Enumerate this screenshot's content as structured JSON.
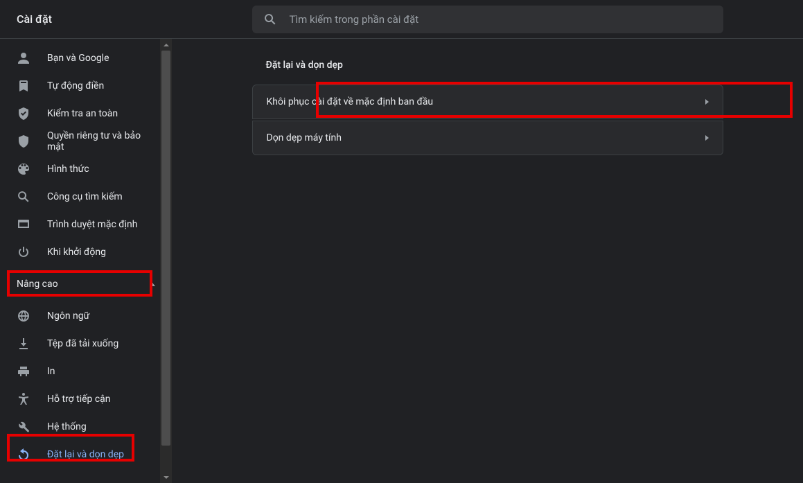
{
  "header": {
    "title": "Cài đặt",
    "search_placeholder": "Tìm kiếm trong phần cài đặt"
  },
  "sidebar": {
    "basic": [
      {
        "icon": "person",
        "label": "Bạn và Google"
      },
      {
        "icon": "autofill",
        "label": "Tự động điền"
      },
      {
        "icon": "safety",
        "label": "Kiểm tra an toàn"
      },
      {
        "icon": "privacy",
        "label": "Quyền riêng tư và bảo mật"
      },
      {
        "icon": "palette",
        "label": "Hình thức"
      },
      {
        "icon": "search",
        "label": "Công cụ tìm kiếm"
      },
      {
        "icon": "browser",
        "label": "Trình duyệt mặc định"
      },
      {
        "icon": "power",
        "label": "Khi khởi động"
      }
    ],
    "advanced_label": "Nâng cao",
    "advanced": [
      {
        "icon": "globe",
        "label": "Ngôn ngữ"
      },
      {
        "icon": "download",
        "label": "Tệp đã tải xuống"
      },
      {
        "icon": "print",
        "label": "In"
      },
      {
        "icon": "a11y",
        "label": "Hỗ trợ tiếp cận"
      },
      {
        "icon": "wrench",
        "label": "Hệ thống"
      },
      {
        "icon": "reset",
        "label": "Đặt lại và dọn dẹp",
        "active": true
      }
    ]
  },
  "main": {
    "section_title": "Đặt lại và dọn dẹp",
    "rows": [
      {
        "label": "Khôi phục cài đặt về mặc định ban đầu"
      },
      {
        "label": "Dọn dẹp máy tính"
      }
    ]
  }
}
